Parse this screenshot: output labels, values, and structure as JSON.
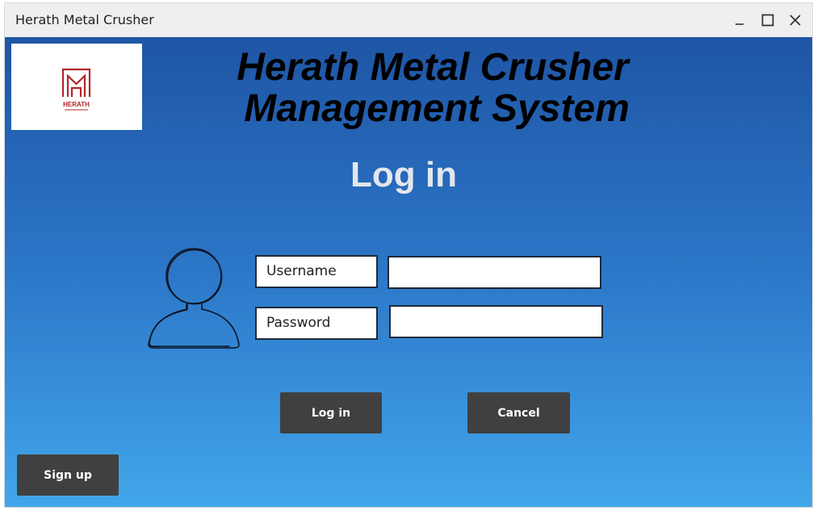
{
  "window": {
    "title": "Herath Metal Crusher",
    "controls": [
      "minimize-icon",
      "maximize-icon",
      "close-icon"
    ]
  },
  "logo": {
    "text": "HERATH",
    "color": "#b3262a"
  },
  "header": {
    "line1": "Herath Metal Crusher",
    "line2": "Management System"
  },
  "login": {
    "title": "Log in",
    "username_label": "Username",
    "username_value": "",
    "password_label": "Password",
    "password_value": "",
    "login_button": "Log in",
    "cancel_button": "Cancel",
    "signup_button": "Sign up"
  },
  "colors": {
    "gradient_top": "#1f55a5",
    "gradient_bottom": "#42a6ea",
    "button_bg": "#404040",
    "title_text": "#e4e6ec"
  }
}
